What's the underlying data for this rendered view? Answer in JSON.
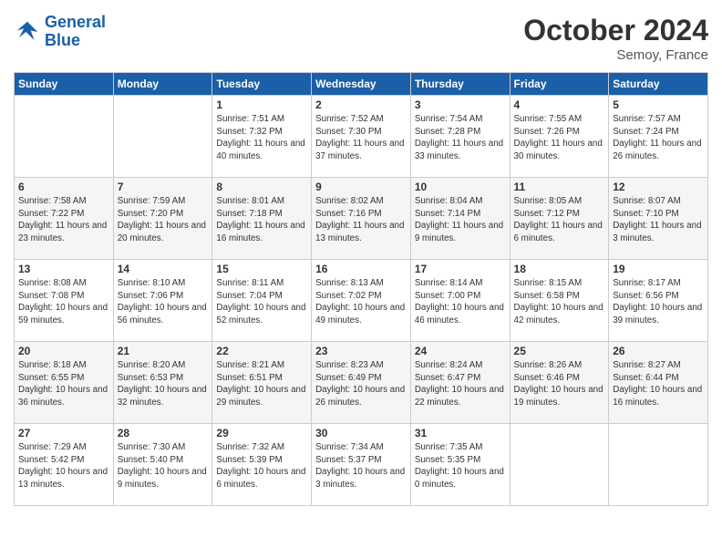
{
  "logo": {
    "line1": "General",
    "line2": "Blue"
  },
  "title": "October 2024",
  "location": "Semoy, France",
  "weekdays": [
    "Sunday",
    "Monday",
    "Tuesday",
    "Wednesday",
    "Thursday",
    "Friday",
    "Saturday"
  ],
  "weeks": [
    [
      {
        "day": "",
        "info": ""
      },
      {
        "day": "",
        "info": ""
      },
      {
        "day": "1",
        "sunrise": "7:51 AM",
        "sunset": "7:32 PM",
        "daylight": "11 hours and 40 minutes."
      },
      {
        "day": "2",
        "sunrise": "7:52 AM",
        "sunset": "7:30 PM",
        "daylight": "11 hours and 37 minutes."
      },
      {
        "day": "3",
        "sunrise": "7:54 AM",
        "sunset": "7:28 PM",
        "daylight": "11 hours and 33 minutes."
      },
      {
        "day": "4",
        "sunrise": "7:55 AM",
        "sunset": "7:26 PM",
        "daylight": "11 hours and 30 minutes."
      },
      {
        "day": "5",
        "sunrise": "7:57 AM",
        "sunset": "7:24 PM",
        "daylight": "11 hours and 26 minutes."
      }
    ],
    [
      {
        "day": "6",
        "sunrise": "7:58 AM",
        "sunset": "7:22 PM",
        "daylight": "11 hours and 23 minutes."
      },
      {
        "day": "7",
        "sunrise": "7:59 AM",
        "sunset": "7:20 PM",
        "daylight": "11 hours and 20 minutes."
      },
      {
        "day": "8",
        "sunrise": "8:01 AM",
        "sunset": "7:18 PM",
        "daylight": "11 hours and 16 minutes."
      },
      {
        "day": "9",
        "sunrise": "8:02 AM",
        "sunset": "7:16 PM",
        "daylight": "11 hours and 13 minutes."
      },
      {
        "day": "10",
        "sunrise": "8:04 AM",
        "sunset": "7:14 PM",
        "daylight": "11 hours and 9 minutes."
      },
      {
        "day": "11",
        "sunrise": "8:05 AM",
        "sunset": "7:12 PM",
        "daylight": "11 hours and 6 minutes."
      },
      {
        "day": "12",
        "sunrise": "8:07 AM",
        "sunset": "7:10 PM",
        "daylight": "11 hours and 3 minutes."
      }
    ],
    [
      {
        "day": "13",
        "sunrise": "8:08 AM",
        "sunset": "7:08 PM",
        "daylight": "10 hours and 59 minutes."
      },
      {
        "day": "14",
        "sunrise": "8:10 AM",
        "sunset": "7:06 PM",
        "daylight": "10 hours and 56 minutes."
      },
      {
        "day": "15",
        "sunrise": "8:11 AM",
        "sunset": "7:04 PM",
        "daylight": "10 hours and 52 minutes."
      },
      {
        "day": "16",
        "sunrise": "8:13 AM",
        "sunset": "7:02 PM",
        "daylight": "10 hours and 49 minutes."
      },
      {
        "day": "17",
        "sunrise": "8:14 AM",
        "sunset": "7:00 PM",
        "daylight": "10 hours and 46 minutes."
      },
      {
        "day": "18",
        "sunrise": "8:15 AM",
        "sunset": "6:58 PM",
        "daylight": "10 hours and 42 minutes."
      },
      {
        "day": "19",
        "sunrise": "8:17 AM",
        "sunset": "6:56 PM",
        "daylight": "10 hours and 39 minutes."
      }
    ],
    [
      {
        "day": "20",
        "sunrise": "8:18 AM",
        "sunset": "6:55 PM",
        "daylight": "10 hours and 36 minutes."
      },
      {
        "day": "21",
        "sunrise": "8:20 AM",
        "sunset": "6:53 PM",
        "daylight": "10 hours and 32 minutes."
      },
      {
        "day": "22",
        "sunrise": "8:21 AM",
        "sunset": "6:51 PM",
        "daylight": "10 hours and 29 minutes."
      },
      {
        "day": "23",
        "sunrise": "8:23 AM",
        "sunset": "6:49 PM",
        "daylight": "10 hours and 26 minutes."
      },
      {
        "day": "24",
        "sunrise": "8:24 AM",
        "sunset": "6:47 PM",
        "daylight": "10 hours and 22 minutes."
      },
      {
        "day": "25",
        "sunrise": "8:26 AM",
        "sunset": "6:46 PM",
        "daylight": "10 hours and 19 minutes."
      },
      {
        "day": "26",
        "sunrise": "8:27 AM",
        "sunset": "6:44 PM",
        "daylight": "10 hours and 16 minutes."
      }
    ],
    [
      {
        "day": "27",
        "sunrise": "7:29 AM",
        "sunset": "5:42 PM",
        "daylight": "10 hours and 13 minutes."
      },
      {
        "day": "28",
        "sunrise": "7:30 AM",
        "sunset": "5:40 PM",
        "daylight": "10 hours and 9 minutes."
      },
      {
        "day": "29",
        "sunrise": "7:32 AM",
        "sunset": "5:39 PM",
        "daylight": "10 hours and 6 minutes."
      },
      {
        "day": "30",
        "sunrise": "7:34 AM",
        "sunset": "5:37 PM",
        "daylight": "10 hours and 3 minutes."
      },
      {
        "day": "31",
        "sunrise": "7:35 AM",
        "sunset": "5:35 PM",
        "daylight": "10 hours and 0 minutes."
      },
      {
        "day": "",
        "info": ""
      },
      {
        "day": "",
        "info": ""
      }
    ]
  ]
}
